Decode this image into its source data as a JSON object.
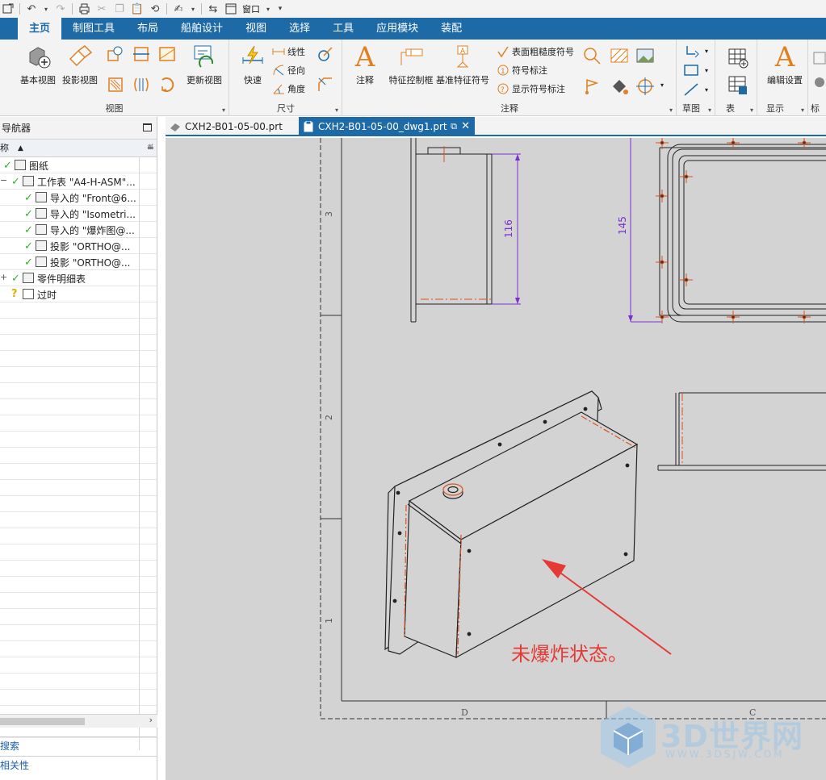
{
  "quick_access": {
    "window_label": "窗口"
  },
  "ribbon_tabs": [
    "主页",
    "制图工具",
    "布局",
    "船舶设计",
    "视图",
    "选择",
    "工具",
    "应用模块",
    "装配"
  ],
  "ribbon": {
    "view_group": {
      "label": "视图",
      "base_view": "基本视图",
      "projected_view": "投影视图",
      "update_view": "更新视图"
    },
    "dimension_group": {
      "label": "尺寸",
      "rapid": "快速",
      "linear": "线性",
      "radial": "径向",
      "angular": "角度"
    },
    "annotation_group": {
      "label": "注释",
      "note": "注释",
      "fcf": "特征控制框",
      "datum": "基准特征符号",
      "surface_finish": "表面粗糙度符号",
      "symbol_note": "符号标注",
      "show_symbol_note": "显示符号标注"
    },
    "sketch_group": {
      "label": "草图"
    },
    "table_group": {
      "label": "表"
    },
    "display_group": {
      "label": "显示",
      "edit_settings": "编辑设置"
    },
    "cut_group": {
      "label": "标"
    }
  },
  "navigator": {
    "title": "导航器",
    "column_header": "称",
    "tree": [
      {
        "label": "图纸",
        "status": "check",
        "level": 0
      },
      {
        "label": "工作表 \"A4-H-ASM\"...",
        "status": "check",
        "level": 1
      },
      {
        "label": "导入的 \"Front@6...",
        "status": "check",
        "level": 2
      },
      {
        "label": "导入的 \"Isometri...",
        "status": "check",
        "level": 2
      },
      {
        "label": "导入的 \"爆炸图@...",
        "status": "check",
        "level": 2
      },
      {
        "label": "投影 \"ORTHO@...",
        "status": "check",
        "level": 2
      },
      {
        "label": "投影 \"ORTHO@...",
        "status": "check",
        "level": 2
      },
      {
        "label": "零件明细表",
        "status": "check",
        "level": 1
      },
      {
        "label": "过时",
        "status": "question",
        "level": 1
      }
    ],
    "footer": [
      "搜索",
      "相关性"
    ]
  },
  "document_tabs": [
    {
      "label": "CXH2-B01-05-00.prt",
      "active": false
    },
    {
      "label": "CXH2-B01-05-00_dwg1.prt",
      "active": true
    }
  ],
  "drawing": {
    "dim_vertical_1": "116",
    "dim_vertical_2": "145",
    "zone_labels_left": [
      "3",
      "2",
      "1"
    ],
    "zone_labels_bottom": [
      "D",
      "C"
    ],
    "annotation": "未爆炸状态。",
    "annotation_color": "#e53935"
  },
  "watermark": {
    "main": "3D世界网",
    "sub": "WWW.3DSJW.COM"
  },
  "colors": {
    "ribbon_blue": "#1d6aa6",
    "dimension": "#7b2fd0",
    "center_mark": "#d9531e",
    "check": "#2bb52b"
  }
}
